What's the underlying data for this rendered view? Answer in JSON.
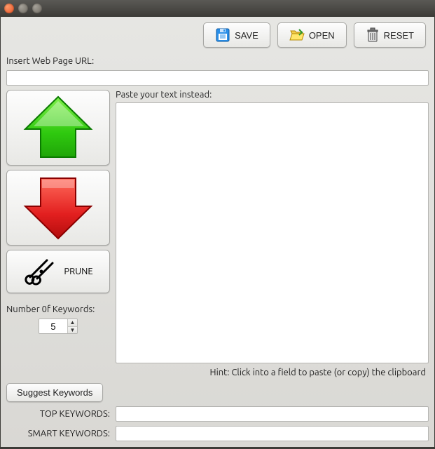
{
  "toolbar": {
    "save_label": "SAVE",
    "open_label": "OPEN",
    "reset_label": "RESET"
  },
  "labels": {
    "url_label": "Insert Web Page URL:",
    "paste_label": "Paste your text instead:",
    "num_keywords_label": "Number 0f Keywords:",
    "prune_label": "PRUNE",
    "hint": "Hint: Click into a field to paste (or copy) the clipboard",
    "suggest_label": "Suggest Keywords",
    "top_keywords_label": "TOP KEYWORDS:",
    "smart_keywords_label": "SMART KEYWORDS:"
  },
  "values": {
    "url": "",
    "paste_text": "",
    "num_keywords": "5",
    "top_keywords": "",
    "smart_keywords": ""
  }
}
